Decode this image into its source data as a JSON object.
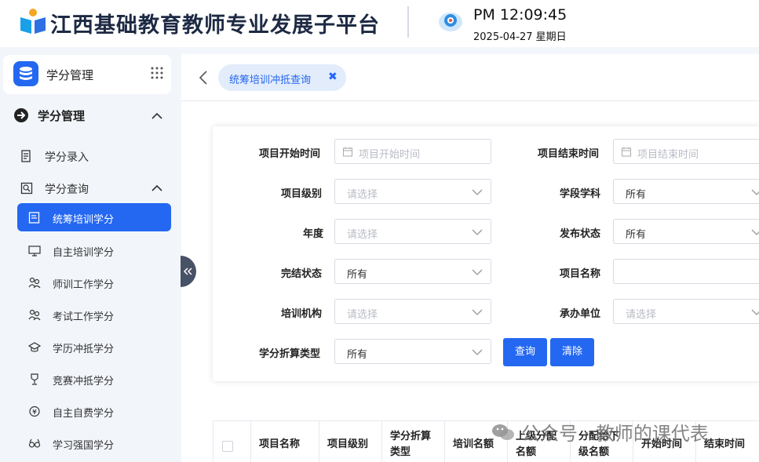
{
  "header": {
    "site_title": "江西基础教育教师专业发展子平台",
    "time": "PM 12:09:45",
    "date": "2025-04-27 星期日"
  },
  "sidebar": {
    "module_title": "学分管理",
    "section_title": "学分管理",
    "items": [
      {
        "label": "学分录入",
        "icon": "document-icon"
      },
      {
        "label": "学分查询",
        "icon": "search-doc-icon"
      }
    ],
    "sub_items": [
      {
        "label": "统筹培训学分",
        "icon": "report-icon",
        "active": true
      },
      {
        "label": "自主培训学分",
        "icon": "monitor-icon"
      },
      {
        "label": "师训工作学分",
        "icon": "people-icon"
      },
      {
        "label": "考试工作学分",
        "icon": "people-icon"
      },
      {
        "label": "学历冲抵学分",
        "icon": "graduation-cap-icon"
      },
      {
        "label": "竞赛冲抵学分",
        "icon": "trophy-icon"
      },
      {
        "label": "自主自费学分",
        "icon": "coin-icon"
      },
      {
        "label": "学习强国学分",
        "icon": "glasses-icon"
      }
    ]
  },
  "tabs": [
    {
      "label": "统筹培训冲抵查询",
      "close": "✖"
    }
  ],
  "filters": {
    "start_time": {
      "label": "项目开始时间",
      "placeholder": "项目开始时间"
    },
    "end_time": {
      "label": "项目结束时间",
      "placeholder": "项目结束时间"
    },
    "level": {
      "label": "项目级别",
      "placeholder": "请选择"
    },
    "subject": {
      "label": "学段学科",
      "value": "所有"
    },
    "year": {
      "label": "年度",
      "placeholder": "请选择"
    },
    "publish_status": {
      "label": "发布状态",
      "value": "所有"
    },
    "finish_status": {
      "label": "完结状态",
      "value": "所有"
    },
    "project_name": {
      "label": "项目名称",
      "value": ""
    },
    "training_org": {
      "label": "培训机构",
      "placeholder": "请选择"
    },
    "host_unit": {
      "label": "承办单位",
      "placeholder": "请选择"
    },
    "credit_type": {
      "label": "学分折算类型",
      "value": "所有"
    }
  },
  "buttons": {
    "query": "查询",
    "clear": "清除"
  },
  "table": {
    "columns": [
      "项目名称",
      "项目级别",
      "学分折算类型",
      "培训名额",
      "上级分配名额",
      "分配给下级名额",
      "开始时间",
      "结束时间"
    ]
  },
  "watermark": "公众号 · 教师的课代表",
  "colors": {
    "primary": "#2468f2",
    "tab_bg": "#e3ecfb",
    "sidebar_bg": "#f2f5fa"
  }
}
